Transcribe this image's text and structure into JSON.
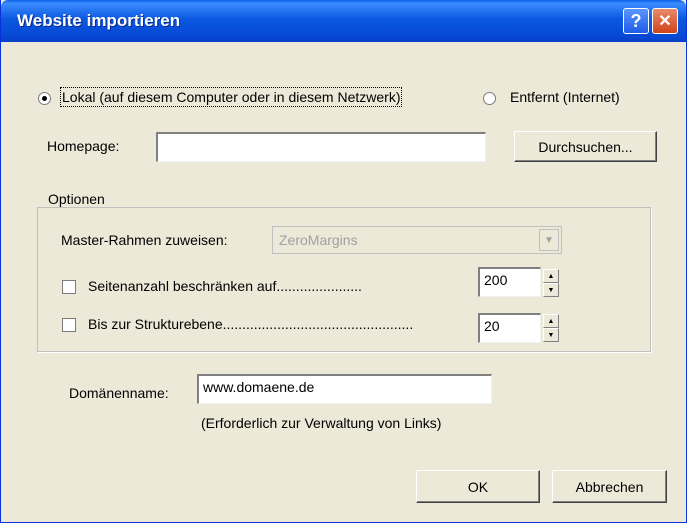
{
  "window": {
    "title": "Website importieren",
    "help_glyph": "?",
    "close_glyph": "✕"
  },
  "source": {
    "local_label": "Lokal (auf diesem Computer oder in diesem Netzwerk)",
    "remote_label": "Entfernt (Internet)",
    "selected": "local"
  },
  "homepage": {
    "label": "Homepage:",
    "value": "",
    "browse_label": "Durchsuchen..."
  },
  "options": {
    "legend": "Optionen",
    "master_label": "Master-Rahmen zuweisen:",
    "master_value": "ZeroMargins",
    "limit_pages_label": "Seitenanzahl beschränken auf......................",
    "limit_pages_checked": false,
    "limit_pages_value": "200",
    "structure_label": "Bis zur Strukturebene.................................................",
    "structure_checked": false,
    "structure_value": "20"
  },
  "domain": {
    "label": "Domänenname:",
    "value": "www.domaene.de",
    "hint": "(Erforderlich zur Verwaltung von Links)"
  },
  "buttons": {
    "ok": "OK",
    "cancel": "Abbrechen"
  },
  "icons": {
    "help": "help-icon",
    "close": "close-icon",
    "combo_arrow": "chevron-down-icon",
    "spin_up": "spin-up-icon",
    "spin_down": "spin-down-icon"
  }
}
